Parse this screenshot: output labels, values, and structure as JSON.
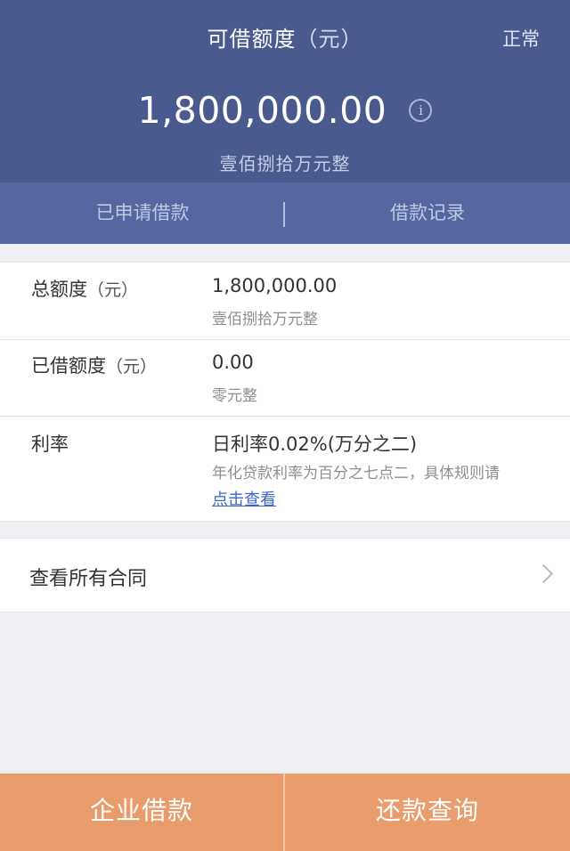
{
  "header": {
    "title": "可借额度",
    "title_unit": "（元）",
    "status": "正常",
    "amount": "1,800,000.00",
    "info_icon_glyph": "i",
    "amount_words": "壹佰捌拾万元整",
    "tabs": [
      {
        "label": "已申请借款"
      },
      {
        "label": "借款记录"
      }
    ]
  },
  "details": {
    "total": {
      "label": "总额度",
      "unit": "（元）",
      "value": "1,800,000.00",
      "sub": "壹佰捌拾万元整"
    },
    "borrowed": {
      "label": "已借额度",
      "unit": "（元）",
      "value": "0.00",
      "sub": "零元整"
    },
    "rate": {
      "label": "利率",
      "value": "日利率0.02%(万分之二)",
      "sub": "年化贷款利率为百分之七点二，具体规则请",
      "link": "点击查看"
    }
  },
  "contracts": {
    "label": "查看所有合同",
    "icon": "chevron-right-icon"
  },
  "bottom": {
    "left_label": "企业借款",
    "right_label": "还款查询"
  },
  "colors": {
    "header_bg": "#4a5a8f",
    "tabs_bg": "#5566a0",
    "button_bg": "#e99c6b",
    "link": "#3d67c9"
  }
}
